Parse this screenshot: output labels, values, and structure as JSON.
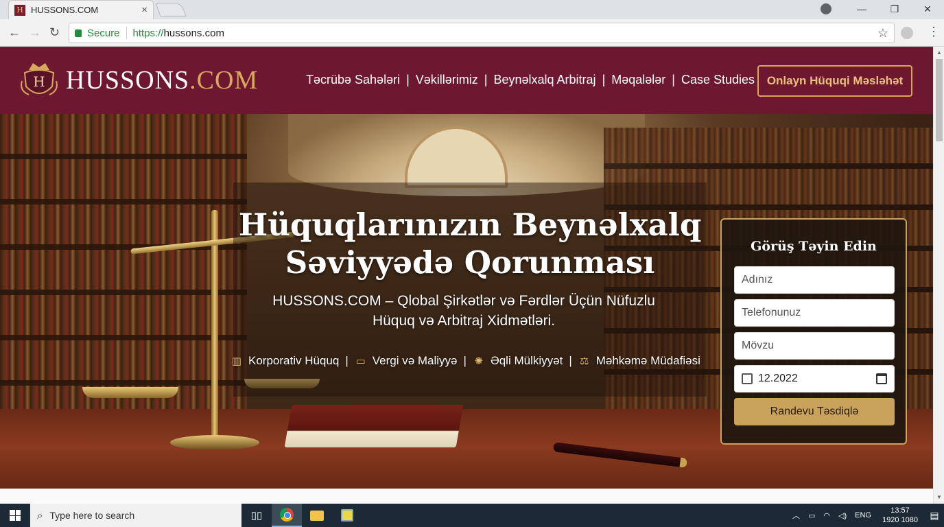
{
  "browser": {
    "tab_title": "HUSSONS.COM",
    "tab_close": "×",
    "secure_label": "Secure",
    "url_scheme": "https://",
    "url_host": "hussons.com",
    "window_controls": [
      "—",
      "❐",
      "✕"
    ]
  },
  "site": {
    "logo_main": "HUSSONS",
    "logo_dot": ".COM",
    "crest_letter": "H",
    "nav": [
      "Təcrübə Sahələri",
      "Vəkillərimiz",
      "Beynəlxalq Arbitraj",
      "Məqalələr",
      "Case Studies"
    ],
    "cta": "Onlayn Hüquqi Məsləhət",
    "hero_title_line1": "Hüquqlarınızın Beynəlxalq",
    "hero_title_line2": "Səviyyədə Qorunması",
    "hero_sub_line1": "HUSSONS.COM – Qlobal Şirkətlər və Fərdlər Üçün Nüfuzlu",
    "hero_sub_line2": "Hüquq və Arbitraj Xidmətləri.",
    "services": [
      {
        "label": "Korporativ Hüquq",
        "icon": "building-icon"
      },
      {
        "label": "Vergi və Maliyyə",
        "icon": "wallet-icon"
      },
      {
        "label": "Əqli Mülkiyyət",
        "icon": "lightbulb-icon"
      },
      {
        "label": "Məhkəmə Müdafiəsi",
        "icon": "gavel-icon"
      }
    ],
    "form": {
      "title": "Görüş Təyin Edin",
      "name_placeholder": "Adınız",
      "phone_placeholder": "Telefonunuz",
      "topic_placeholder": "Mövzu",
      "date_value": "12.2022",
      "submit": "Randevu Təsdiqlə"
    }
  },
  "taskbar": {
    "search_placeholder": "Type here to search",
    "language": "ENG",
    "time": "13:57",
    "date": "1920 1080"
  },
  "colors": {
    "header_bg": "#6d1830",
    "accent_gold": "#c9a35c",
    "secure_green": "#1e8e3e"
  }
}
